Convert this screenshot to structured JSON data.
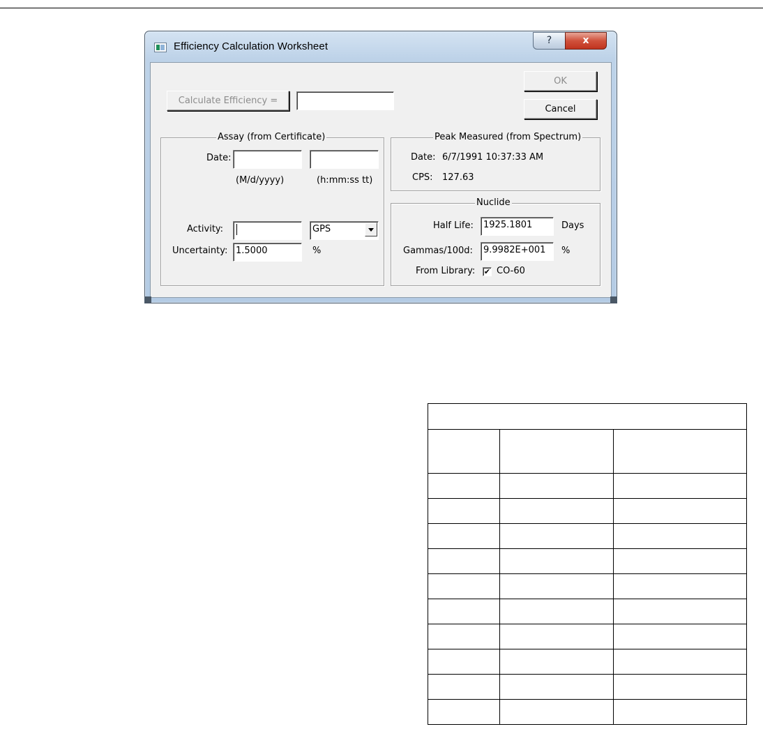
{
  "dialog": {
    "title": "Efficiency Calculation Worksheet",
    "help_glyph": "?",
    "close_glyph": "x"
  },
  "buttons": {
    "calculate_label": "Calculate Efficiency =",
    "ok_label": "OK",
    "cancel_label": "Cancel"
  },
  "efficiency_result": "",
  "assay": {
    "group_label": "Assay (from Certificate)",
    "date_label": "Date:",
    "date_value": "",
    "time_value": "",
    "date_format_hint": "(M/d/yyyy)",
    "time_format_hint": "(h:mm:ss tt)",
    "activity_label": "Activity:",
    "activity_value": "",
    "activity_unit": "GPS",
    "uncertainty_label": "Uncertainty:",
    "uncertainty_value": "1.5000",
    "uncertainty_unit": "%"
  },
  "peak": {
    "group_label": "Peak Measured (from Spectrum)",
    "date_label": "Date:",
    "date_value": "6/7/1991 10:37:33 AM",
    "cps_label": "CPS:",
    "cps_value": "127.63"
  },
  "nuclide": {
    "group_label": "Nuclide",
    "half_life_label": "Half Life:",
    "half_life_value": "1925.1801",
    "half_life_unit": "Days",
    "gammas_label": "Gammas/100d:",
    "gammas_value": "9.9982E+001",
    "gammas_unit": "%",
    "from_library_label": "From Library:",
    "from_library_checked": true,
    "check_glyph": "✔",
    "library_nuclide": "CO-60"
  },
  "table": {
    "caption": "",
    "headers": [
      "",
      "",
      ""
    ],
    "rows": [
      [
        "",
        "",
        ""
      ],
      [
        "",
        "",
        ""
      ],
      [
        "",
        "",
        ""
      ],
      [
        "",
        "",
        ""
      ],
      [
        "",
        "",
        ""
      ],
      [
        "",
        "",
        ""
      ],
      [
        "",
        "",
        ""
      ],
      [
        "",
        "",
        ""
      ],
      [
        "",
        "",
        ""
      ],
      [
        "",
        "",
        ""
      ]
    ]
  }
}
